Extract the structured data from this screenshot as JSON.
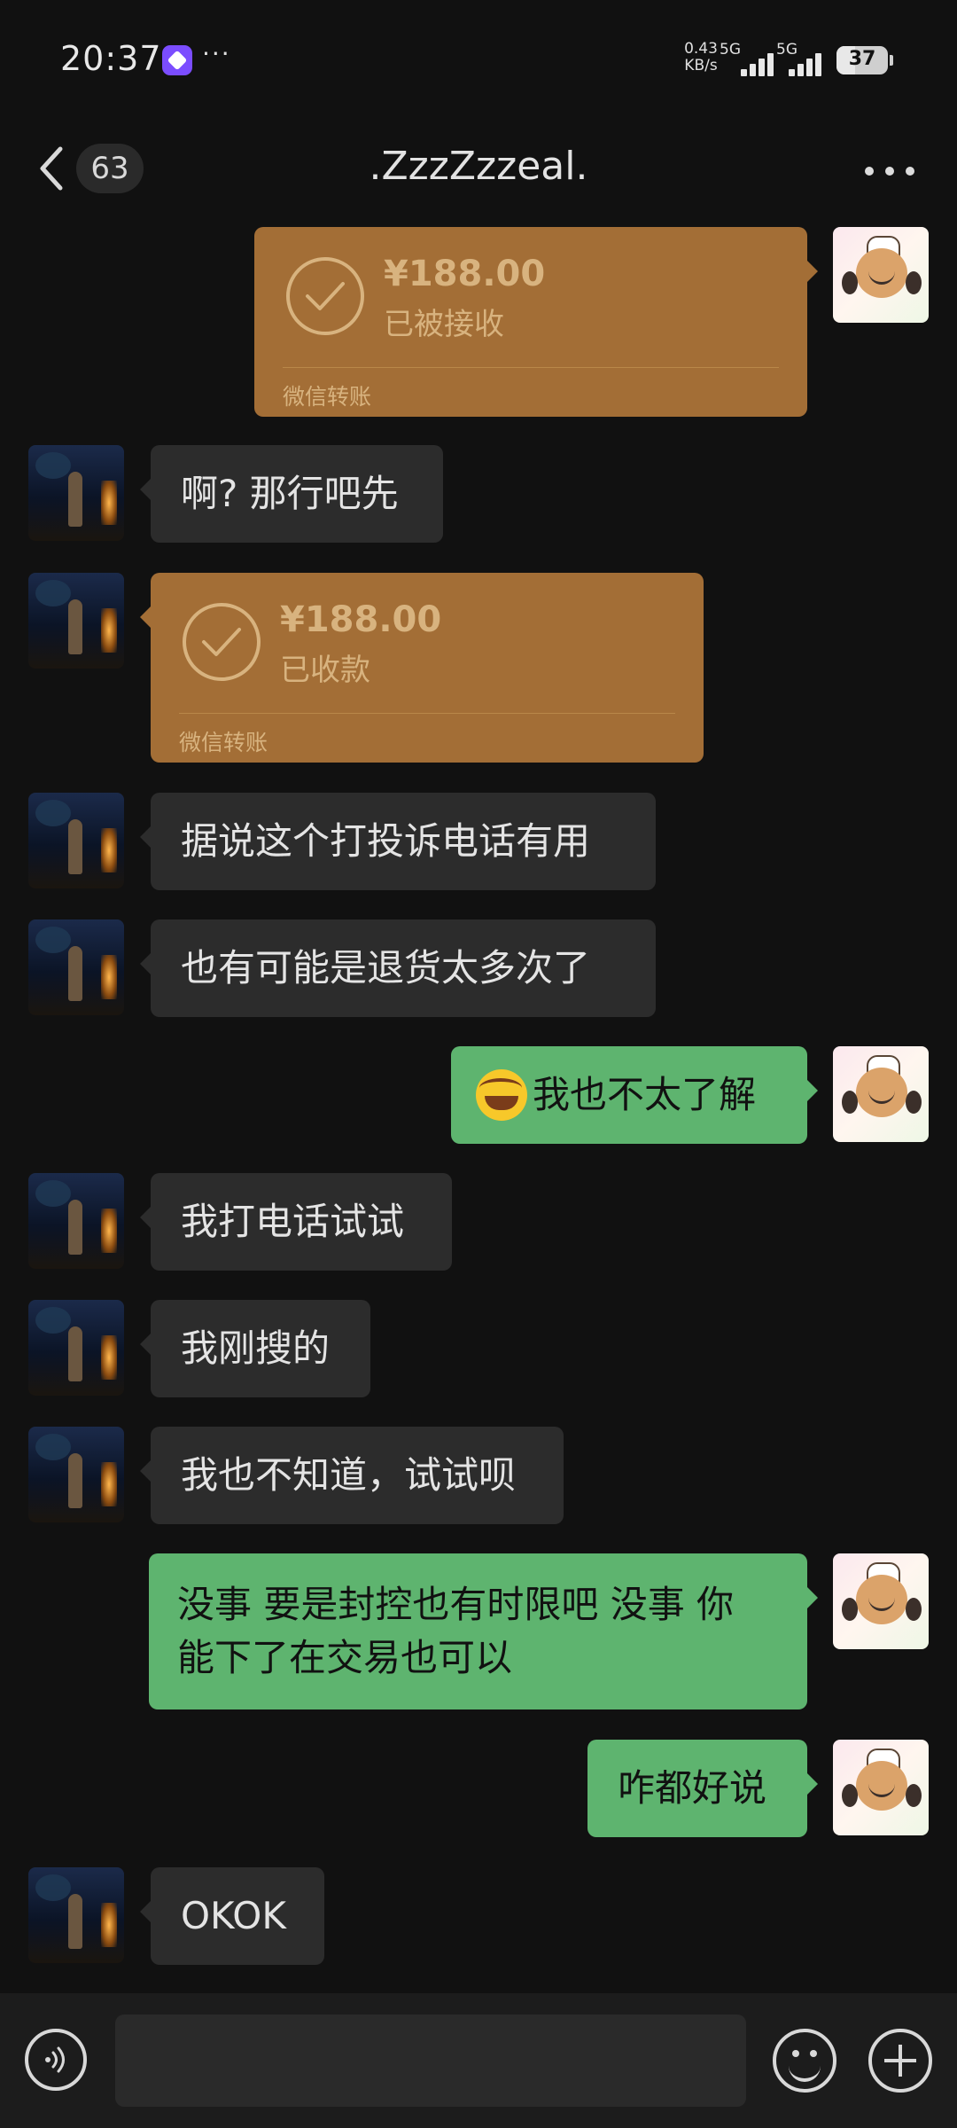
{
  "status_bar": {
    "time": "20:37",
    "app_icon": "app-notification-icon",
    "more": "···",
    "net_speed_value": "0.43",
    "net_speed_unit": "KB/s",
    "sim1_label": "5G",
    "sim2_label": "5G",
    "battery": "37"
  },
  "header": {
    "unread_count": "63",
    "title": ".ZzzZzzeal."
  },
  "messages": [
    {
      "from": "me",
      "type": "transfer",
      "amount": "¥188.00",
      "status": "已被接收",
      "brand": "微信转账"
    },
    {
      "from": "other",
      "type": "text",
      "text": "啊? 那行吧先"
    },
    {
      "from": "other",
      "type": "transfer",
      "amount": "¥188.00",
      "status": "已收款",
      "brand": "微信转账"
    },
    {
      "from": "other",
      "type": "text",
      "text": "据说这个打投诉电话有用"
    },
    {
      "from": "other",
      "type": "text",
      "text": "也有可能是退货太多次了"
    },
    {
      "from": "me",
      "type": "text",
      "text": "我也不太了解",
      "emoji": "facepalm-emoji-icon"
    },
    {
      "from": "other",
      "type": "text",
      "text": "我打电话试试"
    },
    {
      "from": "other",
      "type": "text",
      "text": "我刚搜的"
    },
    {
      "from": "other",
      "type": "text",
      "text": "我也不知道，试试呗"
    },
    {
      "from": "me",
      "type": "text",
      "text_line1": "没事 要是封控也有时限吧 没事 你",
      "text_line2": "能下了在交易也可以"
    },
    {
      "from": "me",
      "type": "text",
      "text": "咋都好说"
    },
    {
      "from": "other",
      "type": "text",
      "text": "OKOK"
    }
  ],
  "input_bar": {
    "voice_icon": "voice-input-icon",
    "placeholder": "",
    "emoji_icon": "emoji-icon",
    "plus_icon": "plus-icon"
  },
  "colors": {
    "background": "#111111",
    "bubble_other": "#2c2c2c",
    "bubble_me": "#5eb46f",
    "transfer": "#a36e36"
  }
}
